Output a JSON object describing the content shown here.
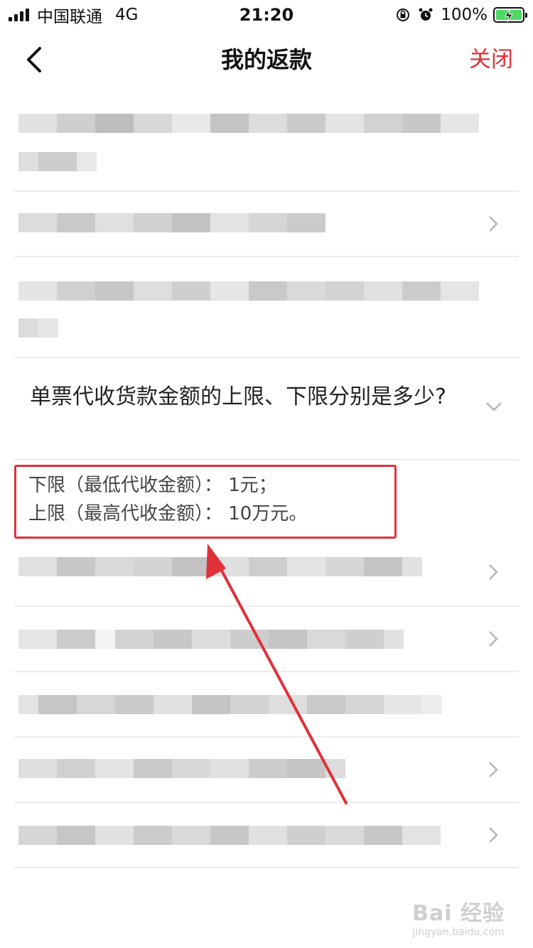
{
  "status_bar": {
    "carrier": "中国联通",
    "network": "4G",
    "time": "21:20",
    "battery": "100%",
    "icons": [
      "signal-icon",
      "orientation-lock-icon",
      "alarm-icon",
      "battery-charging-icon"
    ]
  },
  "nav": {
    "title": "我的返款",
    "close_label": "关闭",
    "back_icon": "back-arrow-icon"
  },
  "faq": {
    "expanded_question": "单票代收货款金额的上限、下限分别是多少?",
    "answer_lines": [
      "下限（最低代收金额）： 1元；",
      "上限（最高代收金额）： 10万元。"
    ]
  },
  "annotation": {
    "highlight_color": "#e0313a"
  },
  "watermark": {
    "logo": "Bai 经验",
    "url": "jingyan.baidu.com"
  },
  "colors": {
    "accent": "#e0313a",
    "divider": "#ececec",
    "text": "#222222"
  }
}
